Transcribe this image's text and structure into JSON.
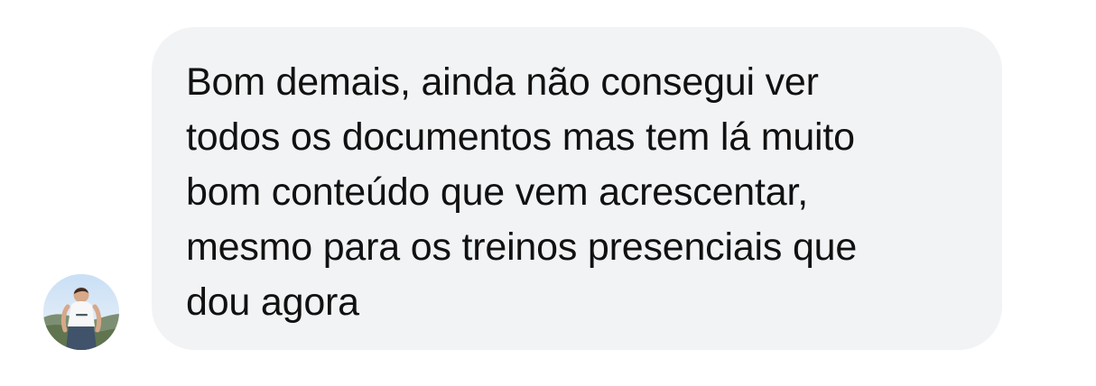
{
  "message": {
    "sender_avatar_icon": "user-avatar-icon",
    "text": "Bom demais, ainda não consegui ver\ntodos os documentos mas tem lá muito\nbom conteúdo que vem acrescentar,\nmesmo para os treinos presenciais que\ndou agora"
  },
  "colors": {
    "bubble_background": "#f2f3f5",
    "text": "#111111",
    "page_background": "#ffffff"
  }
}
